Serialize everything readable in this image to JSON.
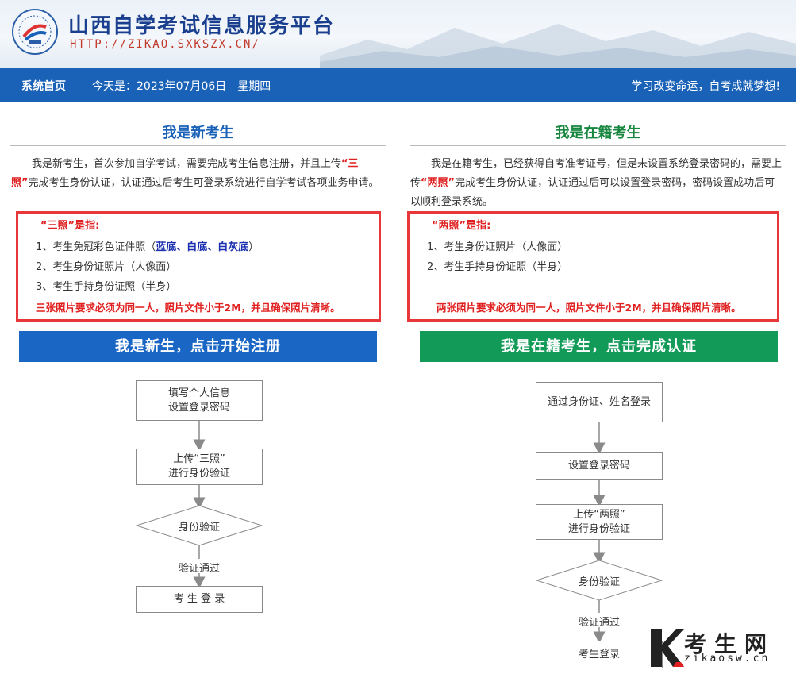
{
  "header": {
    "title": "山西自学考试信息服务平台",
    "url": "HTTP://ZIKAO.SXKSZX.CN/"
  },
  "nav": {
    "home": "系统首页",
    "date": "今天是：2023年07月06日　星期四",
    "slogan": "学习改变命运，自考成就梦想!"
  },
  "new_student": {
    "title": "我是新考生",
    "desc_1": "我是新考生，首次参加自学考试，需要完成考生信息注册，并且上传",
    "desc_highlight": "“三照”",
    "desc_2": "完成考生身份认证，认证通过后考生可登录系统进行自学考试各项业务申请。",
    "req_head": "“三照”是指:",
    "req_1_prefix": "1、考生免冠彩色证件照（",
    "req_1_colors": "蓝底、白底、白灰底",
    "req_1_suffix": "）",
    "req_2": "2、考生身份证照片（人像面）",
    "req_3": "3、考生手持身份证照（半身）",
    "req_note": "三张照片要求必须为同一人，照片文件小于2M，并且确保照片清晰。",
    "action": "我是新生，点击开始注册",
    "flow": {
      "step1a": "填写个人信息",
      "step1b": "设置登录密码",
      "step2a": "上传“三照”",
      "step2b": "进行身份验证",
      "decision": "身份验证",
      "pass": "验证通过",
      "final": "考 生 登 录"
    }
  },
  "enrolled_student": {
    "title": "我是在籍考生",
    "desc_1": "我是在籍考生，已经获得自考准考证号，但是未设置系统登录密码的，需要上传",
    "desc_highlight": "“两照”",
    "desc_2": "完成考生身份认证，认证通过后可以设置登录密码，密码设置成功后可以顺利登录系统。",
    "req_head": "“两照”是指:",
    "req_1": "1、考生身份证照片（人像面）",
    "req_2": "2、考生手持身份证照（半身）",
    "req_note": "两张照片要求必须为同一人，照片文件小于2M，并且确保照片清晰。",
    "action": "我是在籍考生，点击完成认证",
    "flow": {
      "step1": "通过身份证、姓名登录",
      "step2": "设置登录密码",
      "step3a": "上传“两照”",
      "step3b": "进行身份验证",
      "decision": "身份验证",
      "pass": "验证通过",
      "final": "考生登录"
    }
  },
  "watermark": {
    "title": "考生网",
    "url": "zikaosw.cn"
  },
  "colors": {
    "nav_blue": "#1a62b8",
    "new_button": "#1a66c4",
    "enrolled_button": "#129b58",
    "alert_red": "#e02020"
  }
}
